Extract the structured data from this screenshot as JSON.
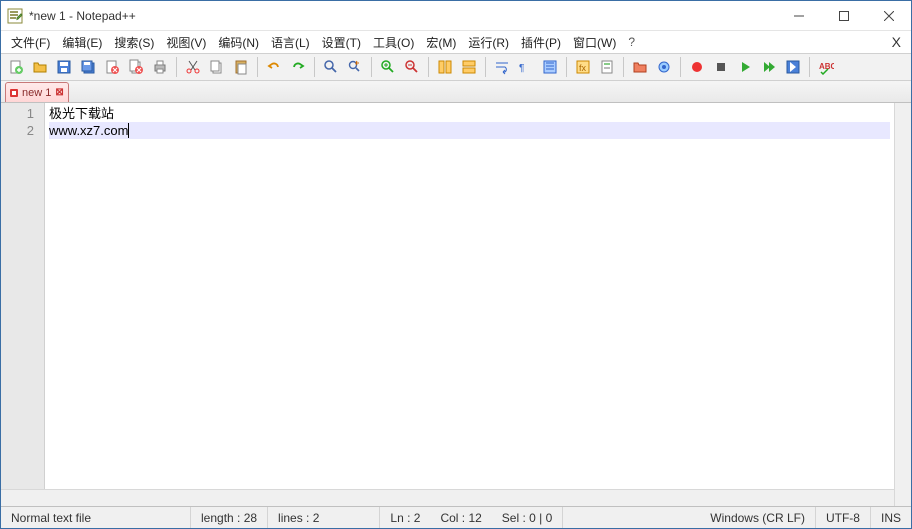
{
  "window": {
    "title": "*new 1 - Notepad++"
  },
  "menu": {
    "items": [
      "文件(F)",
      "编辑(E)",
      "搜索(S)",
      "视图(V)",
      "编码(N)",
      "语言(L)",
      "设置(T)",
      "工具(O)",
      "宏(M)",
      "运行(R)",
      "插件(P)",
      "窗口(W)"
    ],
    "help": "?",
    "right_x": "X"
  },
  "toolbar_icons": [
    "new-file-icon",
    "open-file-icon",
    "save-icon",
    "save-all-icon",
    "close-icon",
    "close-all-icon",
    "print-icon",
    "sep",
    "cut-icon",
    "copy-icon",
    "paste-icon",
    "sep",
    "undo-icon",
    "redo-icon",
    "sep",
    "find-icon",
    "replace-icon",
    "sep",
    "zoom-in-icon",
    "zoom-out-icon",
    "sep",
    "sync-v-icon",
    "sync-h-icon",
    "sep",
    "wordwrap-icon",
    "show-all-icon",
    "indent-guide-icon",
    "sep",
    "lang-icon",
    "doc-map-icon",
    "sep",
    "folder-icon",
    "monitor-icon",
    "sep",
    "record-icon",
    "stop-icon",
    "play-icon",
    "play-multi-icon",
    "save-macro-icon",
    "sep",
    "spellcheck-icon"
  ],
  "tab": {
    "label": "new 1"
  },
  "editor": {
    "lines": [
      "极光下载站",
      "www.xz7.com"
    ],
    "highlight_line_index": 1
  },
  "statusbar": {
    "filetype": "Normal text file",
    "length": "length : 28",
    "lines": "lines : 2",
    "ln": "Ln : 2",
    "col": "Col : 12",
    "sel": "Sel : 0 | 0",
    "eol": "Windows (CR LF)",
    "encoding": "UTF-8",
    "mode": "INS"
  }
}
